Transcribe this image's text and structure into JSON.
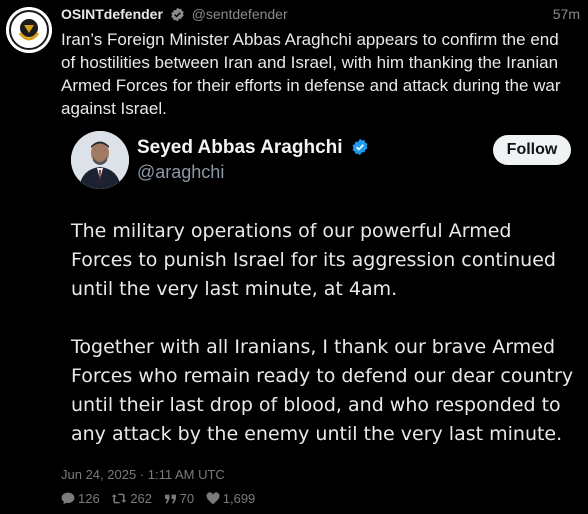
{
  "post": {
    "author": {
      "display_name": "OSINTdefender",
      "handle": "@sentdefender",
      "avatar_icon": "osintdefender-logo-avatar",
      "verified": true
    },
    "time_ago": "57m",
    "text": "Iran’s Foreign Minister Abbas Araghchi appears to confirm the end of hostilities between Iran and Israel, with him thanking the Iranian Armed Forces for their efforts in defense and attack during the war against Israel.",
    "quote": {
      "author": {
        "display_name": "Seyed Abbas Araghchi",
        "handle": "@araghchi",
        "verified": true
      },
      "follow_label": "Follow",
      "paragraphs": [
        "The military operations of our powerful Armed Forces to punish Israel for its aggression continued until the very last minute, at 4am.",
        "Together with all Iranians, I thank our brave Armed Forces who remain ready to defend our dear country until their last drop of blood, and who responded to any attack by the enemy until the very last minute."
      ]
    },
    "date": "Jun 24, 2025 · 1:11 AM UTC",
    "stats": {
      "replies": "126",
      "reposts": "262",
      "quotes": "70",
      "likes": "1,699"
    }
  },
  "colors": {
    "background": "#000000",
    "text": "#e7e9ea",
    "muted": "#8b8b8b",
    "verified_blue": "#1d9bf0",
    "follow_bg": "#eff3f4"
  }
}
